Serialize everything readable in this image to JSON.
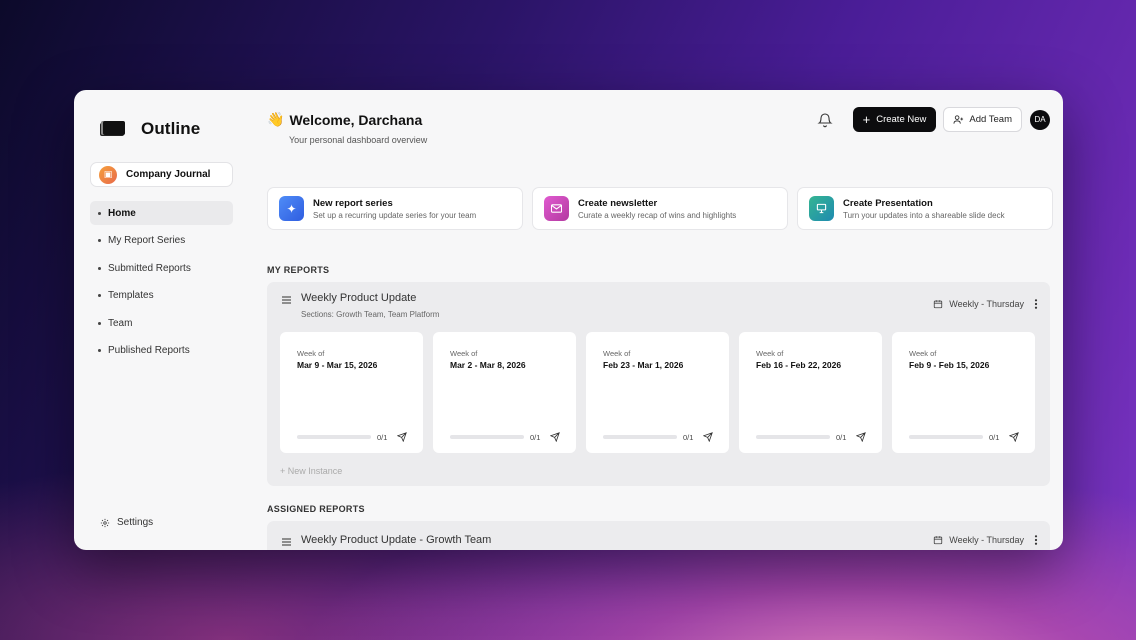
{
  "brand": {
    "name": "Outline"
  },
  "workspace": {
    "name": "Company Journal"
  },
  "nav": [
    {
      "label": "Home",
      "active": true
    },
    {
      "label": "My Report Series"
    },
    {
      "label": "Submitted Reports"
    },
    {
      "label": "Templates"
    },
    {
      "label": "Team"
    },
    {
      "label": "Published Reports"
    }
  ],
  "settings_label": "Settings",
  "header": {
    "wave": "👋",
    "title": "Welcome, Darchana",
    "subtitle": "Your personal dashboard overview",
    "create_label": "Create New",
    "add_team_label": "Add Team",
    "user_initials": "DA"
  },
  "quick_actions": [
    {
      "title": "New report series",
      "desc": "Set up a recurring update series for your team",
      "icon": "plus-sparkle-icon",
      "color": "#3b6ff2"
    },
    {
      "title": "Create newsletter",
      "desc": "Curate a weekly recap of wins and highlights",
      "icon": "mail-icon",
      "color": "#d446a8"
    },
    {
      "title": "Create Presentation",
      "desc": "Turn your updates into a shareable slide deck",
      "icon": "presentation-icon",
      "color": "#24a38f"
    }
  ],
  "my_reports": {
    "label": "MY REPORTS",
    "series": {
      "title": "Weekly Product Update",
      "sections": "Sections: Growth Team, Team Platform",
      "schedule": "Weekly - Thursday",
      "weeks": [
        {
          "label": "Week of",
          "range": "Mar 9 - Mar 15, 2026",
          "count": "0/1",
          "progress": 0
        },
        {
          "label": "Week of",
          "range": "Mar 2 - Mar 8, 2026",
          "count": "0/1",
          "progress": 0
        },
        {
          "label": "Week of",
          "range": "Feb 23 - Mar 1, 2026",
          "count": "0/1",
          "progress": 0
        },
        {
          "label": "Week of",
          "range": "Feb 16 - Feb 22, 2026",
          "count": "0/1",
          "progress": 0
        },
        {
          "label": "Week of",
          "range": "Feb 9 - Feb 15, 2026",
          "count": "0/1",
          "progress": 0
        }
      ],
      "new_instance": "+ New Instance"
    }
  },
  "assigned_reports": {
    "label": "ASSIGNED REPORTS",
    "series": {
      "title": "Weekly Product Update - Growth Team",
      "schedule": "Weekly - Thursday"
    }
  }
}
